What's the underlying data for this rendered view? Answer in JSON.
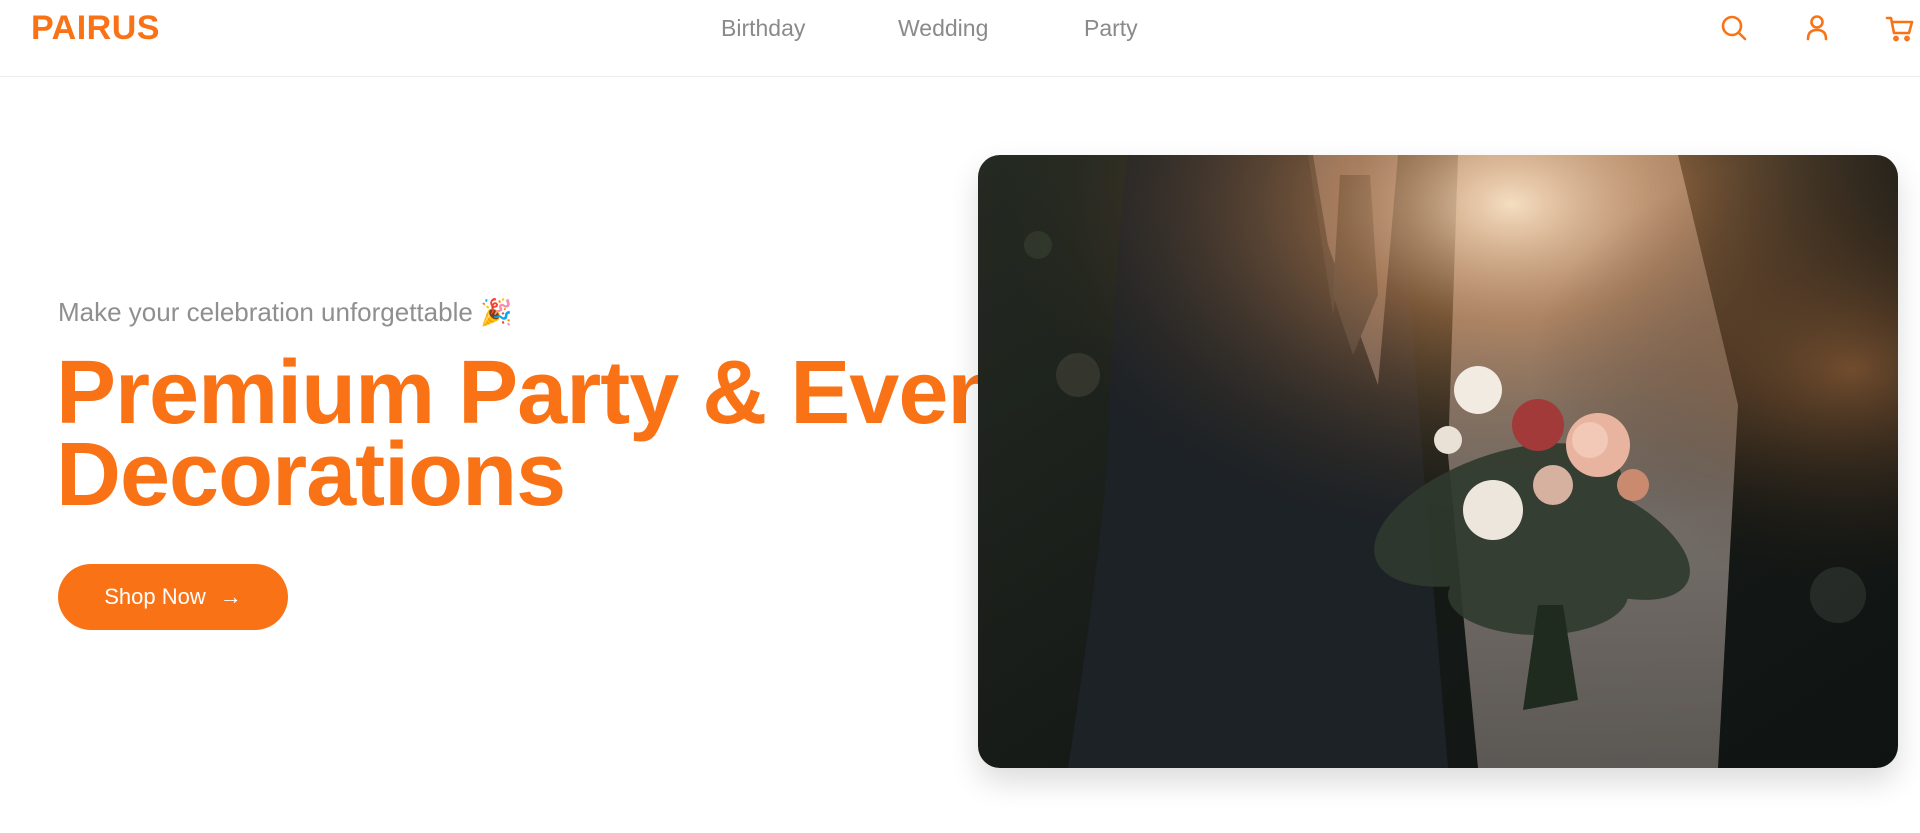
{
  "brand": {
    "logo_text": "PAIRUS",
    "accent": "#f97316"
  },
  "nav": {
    "items": [
      "Birthday",
      "Wedding",
      "Party"
    ]
  },
  "header_icons": [
    "search-icon",
    "user-icon",
    "cart-icon"
  ],
  "hero": {
    "eyebrow": "Make your celebration unforgettable 🎉",
    "heading_line1": "Premium Party & Event",
    "heading_line2": "Decorations",
    "cta_label": "Shop Now",
    "cta_arrow": "→",
    "image_icon": "wedding-photo"
  }
}
